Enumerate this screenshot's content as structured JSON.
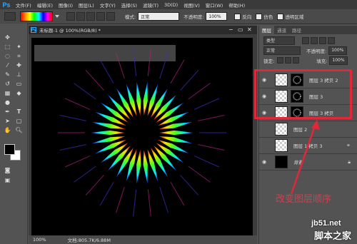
{
  "app": {
    "logo": "Ps"
  },
  "menubar": {
    "items": [
      "文件(F)",
      "编辑(E)",
      "图像(I)",
      "图层(L)",
      "文字(Y)",
      "选择(S)",
      "滤镜(T)",
      "3D(D)",
      "视图(V)",
      "窗口(W)",
      "帮助(H)"
    ]
  },
  "options": {
    "mode_label": "模式:",
    "mode_value": "正常",
    "opacity_label": "不透明度:",
    "opacity_value": "100%",
    "reverse": "反向",
    "dither": "仿色",
    "transparency": "透明区域"
  },
  "document": {
    "tab_title": "未标题-1 @ 100%(RGB/8) *",
    "zoom": "100%",
    "doc_info": "文档:805.7K/6.88M"
  },
  "panel": {
    "tabs": [
      "图层",
      "通道",
      "路径"
    ],
    "kind_filter": "类型",
    "blend_mode": "正常",
    "opacity_label": "不透明度:",
    "opacity_value": "100%",
    "lock_label": "锁定:",
    "fill_label": "填充:",
    "fill_value": "100%",
    "layers": [
      {
        "name": "图层 3 拷贝 2"
      },
      {
        "name": "图层 3"
      },
      {
        "name": "图层 3 拷贝"
      },
      {
        "name": "图层 2"
      },
      {
        "name": "图层 1 拷贝 3"
      },
      {
        "name": "背景"
      }
    ]
  },
  "annotation": {
    "text": "改变图层顺序"
  },
  "watermark": {
    "site": "jb51.net",
    "brand": "脚本之家"
  },
  "colors": {
    "highlight": "#e0283a",
    "annotation": "#e8344a",
    "ps_blue": "#31a8ff"
  },
  "icons": [
    "eye-icon",
    "lock-icon",
    "close-icon",
    "minimize-icon"
  ]
}
